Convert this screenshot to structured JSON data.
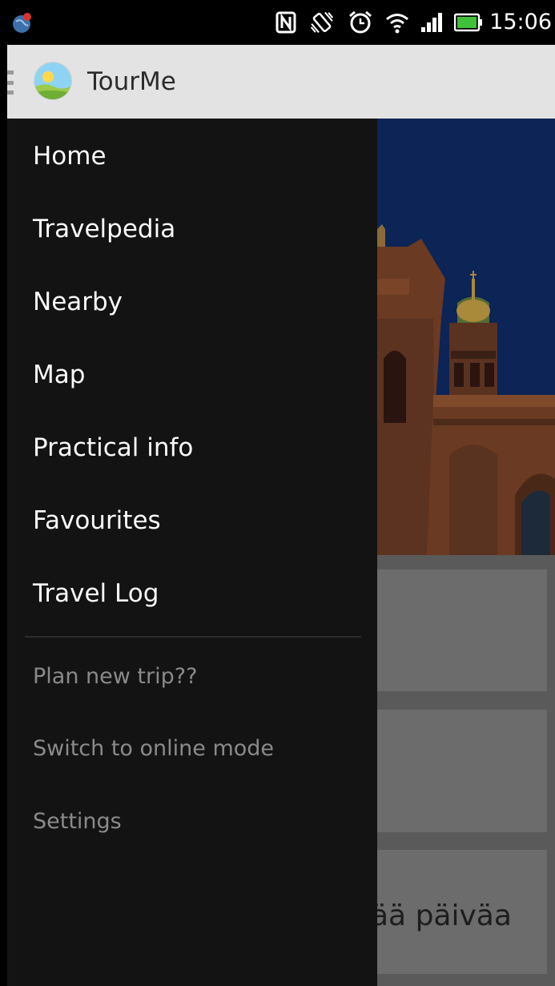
{
  "status_bar": {
    "time": "15:06",
    "icons": [
      "notification-icon",
      "nfc-icon",
      "vibrate-icon",
      "alarm-icon",
      "wifi-icon",
      "signal-icon",
      "battery-icon"
    ]
  },
  "action_bar": {
    "title": "TourMe",
    "icons": [
      "drawer-indicator-icon",
      "app-logo-icon"
    ],
    "background": "#e3e3e3"
  },
  "drawer": {
    "primary_items": [
      {
        "label": "Home"
      },
      {
        "label": "Travelpedia"
      },
      {
        "label": "Nearby"
      },
      {
        "label": "Map"
      },
      {
        "label": "Practical info"
      },
      {
        "label": "Favourites"
      },
      {
        "label": "Travel Log"
      }
    ],
    "secondary_items": [
      {
        "label": "Plan new trip??"
      },
      {
        "label": "Switch to online mode"
      },
      {
        "label": "Settings"
      }
    ],
    "background": "#131313",
    "text_color": "#fafafa",
    "secondary_text_color": "#8a8a8a"
  },
  "content": {
    "card_partial_text": "ää päiväa"
  }
}
